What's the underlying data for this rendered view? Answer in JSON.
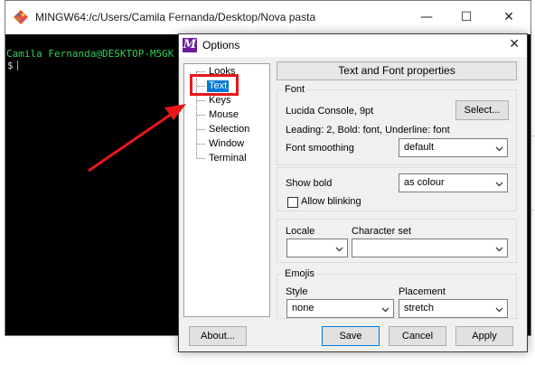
{
  "terminal": {
    "title": "MINGW64:/c/Users/Camila Fernanda/Desktop/Nova pasta",
    "prompt_user": "Camila Fernanda@DESKTOP-M5GK",
    "prompt_symbol": "$",
    "controls": {
      "minimize": "—",
      "maximize": "☐",
      "close": "✕"
    }
  },
  "dialog": {
    "title": "Options",
    "icon_letter": "M",
    "close": "✕",
    "tree": [
      "Looks",
      "Text",
      "Keys",
      "Mouse",
      "Selection",
      "Window",
      "Terminal"
    ],
    "selected_item": "Text",
    "header": "Text and Font properties",
    "font_group": {
      "label": "Font",
      "font_value": "Lucida Console, 9pt",
      "select_button": "Select...",
      "details": "Leading: 2, Bold: font, Underline: font",
      "smoothing_label": "Font smoothing",
      "smoothing_value": "default"
    },
    "bold_group": {
      "show_bold_label": "Show bold",
      "show_bold_value": "as colour",
      "allow_blinking_label": "Allow blinking",
      "allow_blinking_checked": false
    },
    "locale_group": {
      "locale_label": "Locale",
      "locale_value": "",
      "charset_label": "Character set",
      "charset_value": ""
    },
    "emojis_group": {
      "label": "Emojis",
      "style_label": "Style",
      "style_value": "none",
      "placement_label": "Placement",
      "placement_value": "stretch"
    },
    "buttons": {
      "about": "About...",
      "save": "Save",
      "cancel": "Cancel",
      "apply": "Apply"
    }
  },
  "annotation": {
    "color": "#e8161b"
  },
  "colors": {
    "accent": "#0078d7",
    "icon": "#6a1a9a",
    "prompt_green": "#2fd05a"
  }
}
